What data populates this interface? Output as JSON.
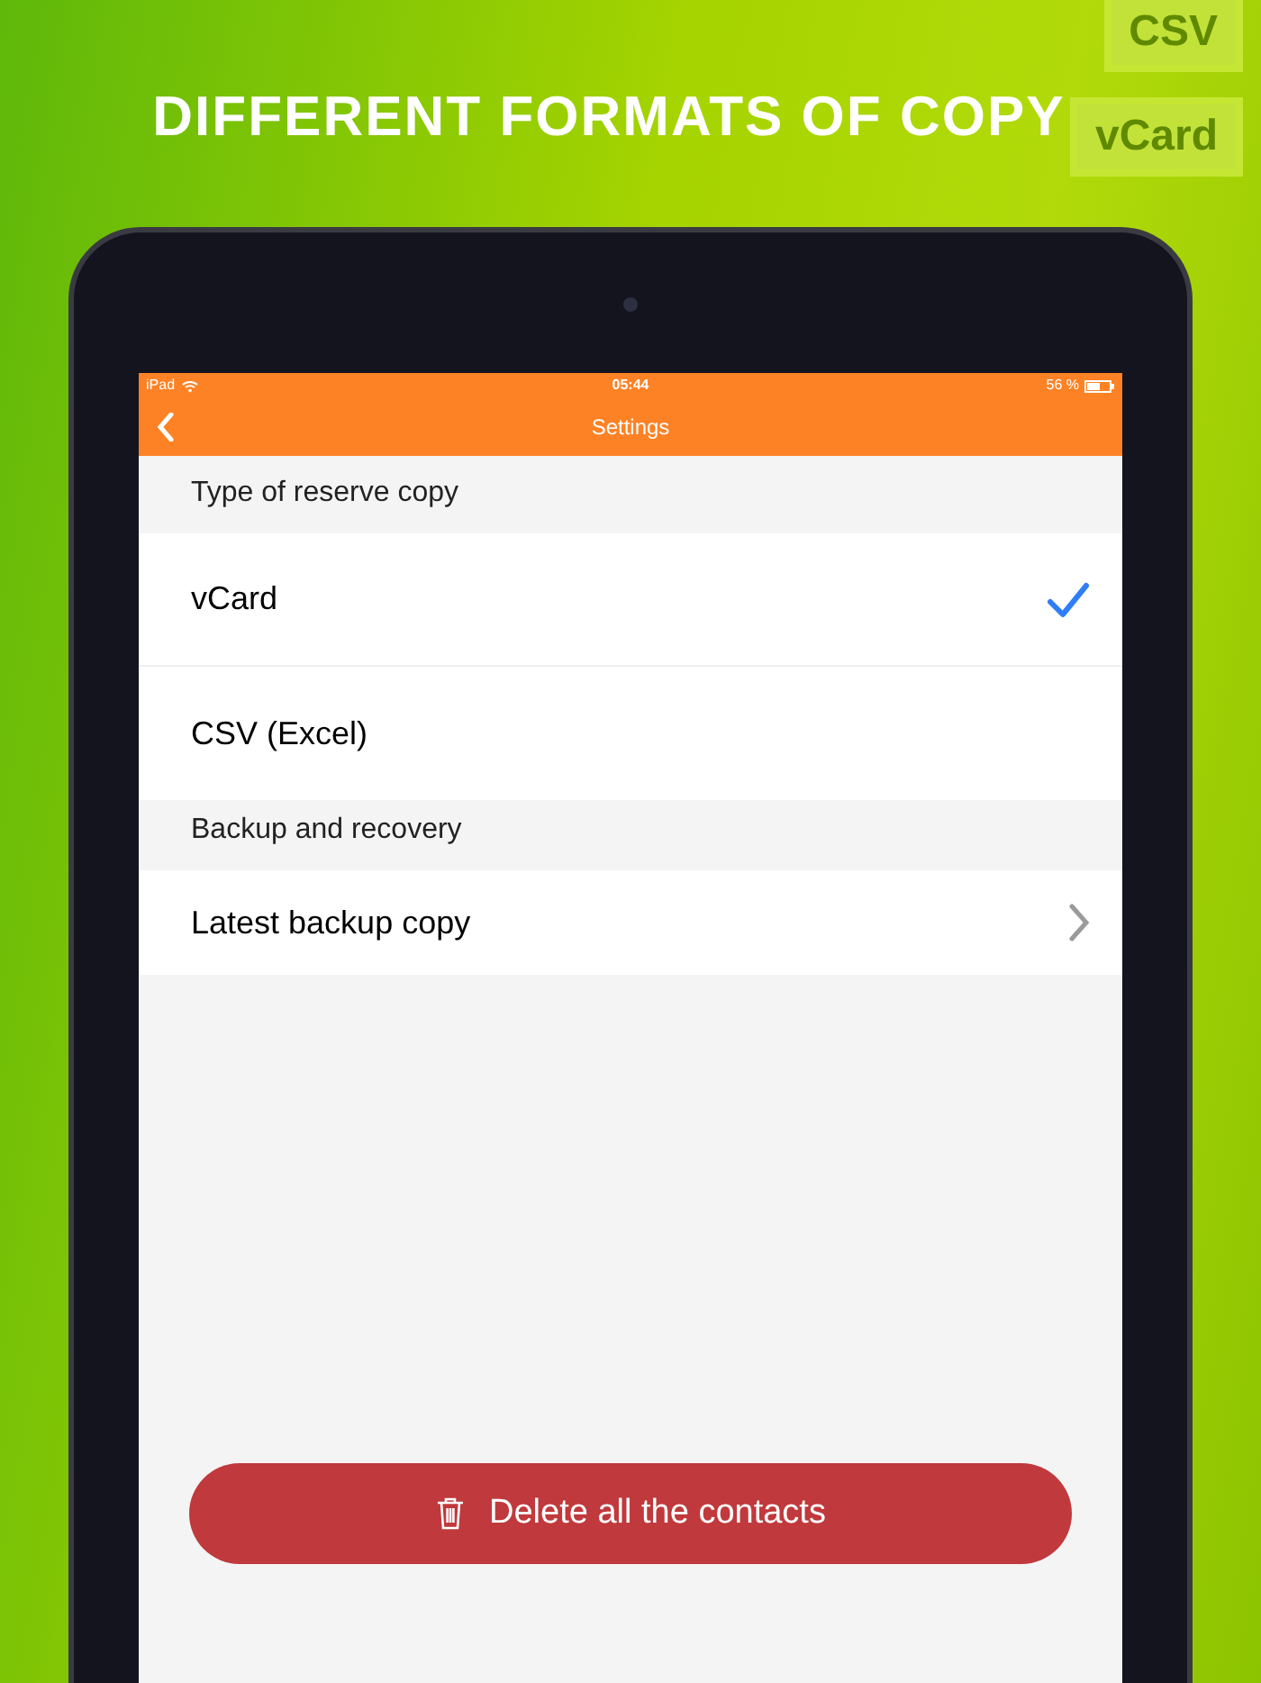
{
  "headline": "DIFFERENT FORMATS OF COPY",
  "decor_labels": [
    "CSV",
    "vCard"
  ],
  "status_bar": {
    "device": "iPad",
    "time": "05:44",
    "battery": "56 %"
  },
  "nav_bar": {
    "title": "Settings"
  },
  "sections": [
    {
      "header": "Type of reserve copy",
      "rows": [
        {
          "label": "vCard",
          "kind": "option",
          "selected": true
        },
        {
          "label": "CSV (Excel)",
          "kind": "option",
          "selected": false
        }
      ]
    },
    {
      "header": "Backup and recovery",
      "rows": [
        {
          "label": "Latest backup copy",
          "kind": "link"
        }
      ]
    }
  ],
  "delete_button": {
    "label": "Delete all the contacts"
  }
}
